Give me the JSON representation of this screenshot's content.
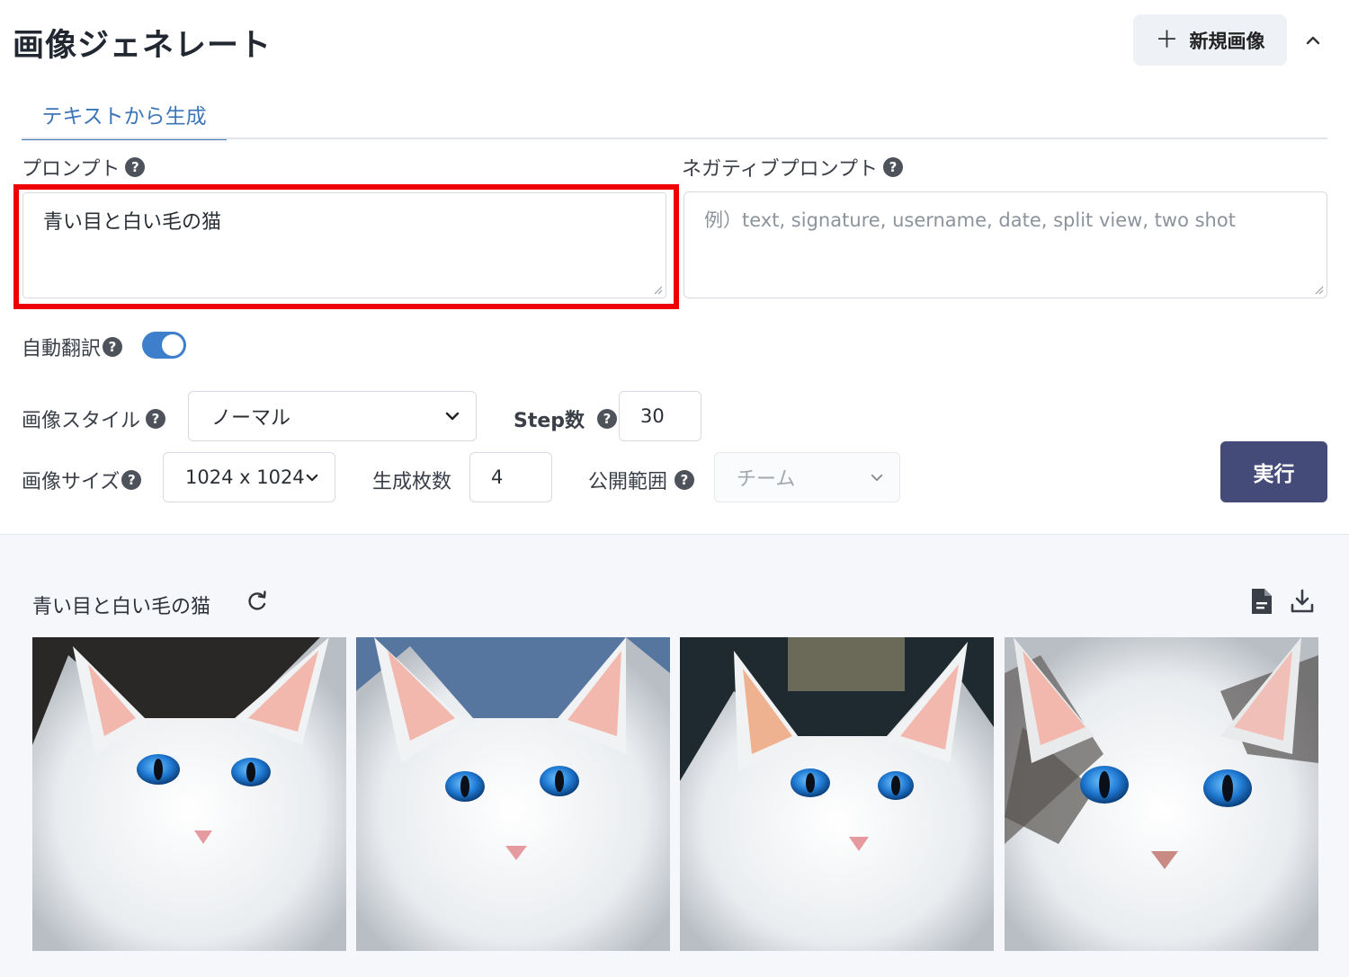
{
  "header": {
    "title": "画像ジェネレート",
    "new_button_label": "新規画像"
  },
  "tabs": [
    {
      "label": "テキストから生成",
      "active": true
    }
  ],
  "prompt": {
    "label": "プロンプト",
    "value": "青い目と白い毛の猫"
  },
  "negative_prompt": {
    "label": "ネガティブプロンプト",
    "placeholder": "例）text, signature, username, date, split view, two shot"
  },
  "auto_translate": {
    "label": "自動翻訳",
    "enabled": true
  },
  "image_style": {
    "label": "画像スタイル",
    "value": "ノーマル"
  },
  "steps": {
    "label": "Step数",
    "value": "30"
  },
  "image_size": {
    "label": "画像サイズ",
    "value": "1024 x 1024"
  },
  "count": {
    "label": "生成枚数",
    "value": "4"
  },
  "visibility": {
    "label": "公開範囲",
    "value": "チーム"
  },
  "run_button_label": "実行",
  "help_glyph": "?",
  "results": {
    "title": "青い目と白い毛の猫",
    "images": [
      {
        "alt": "white cat with blue eyes 1"
      },
      {
        "alt": "white cat with blue eyes 2"
      },
      {
        "alt": "white cat with blue eyes 3"
      },
      {
        "alt": "white and gray cat with blue eyes 4"
      }
    ]
  },
  "colors": {
    "accent": "#3d76b8",
    "toggle": "#3d7fcb",
    "run_button": "#454b78",
    "highlight": "#ee0000"
  },
  "icons": [
    "plus-icon",
    "chevron-up-icon",
    "help-icon",
    "chevron-down-icon",
    "refresh-icon",
    "document-icon",
    "download-icon"
  ]
}
